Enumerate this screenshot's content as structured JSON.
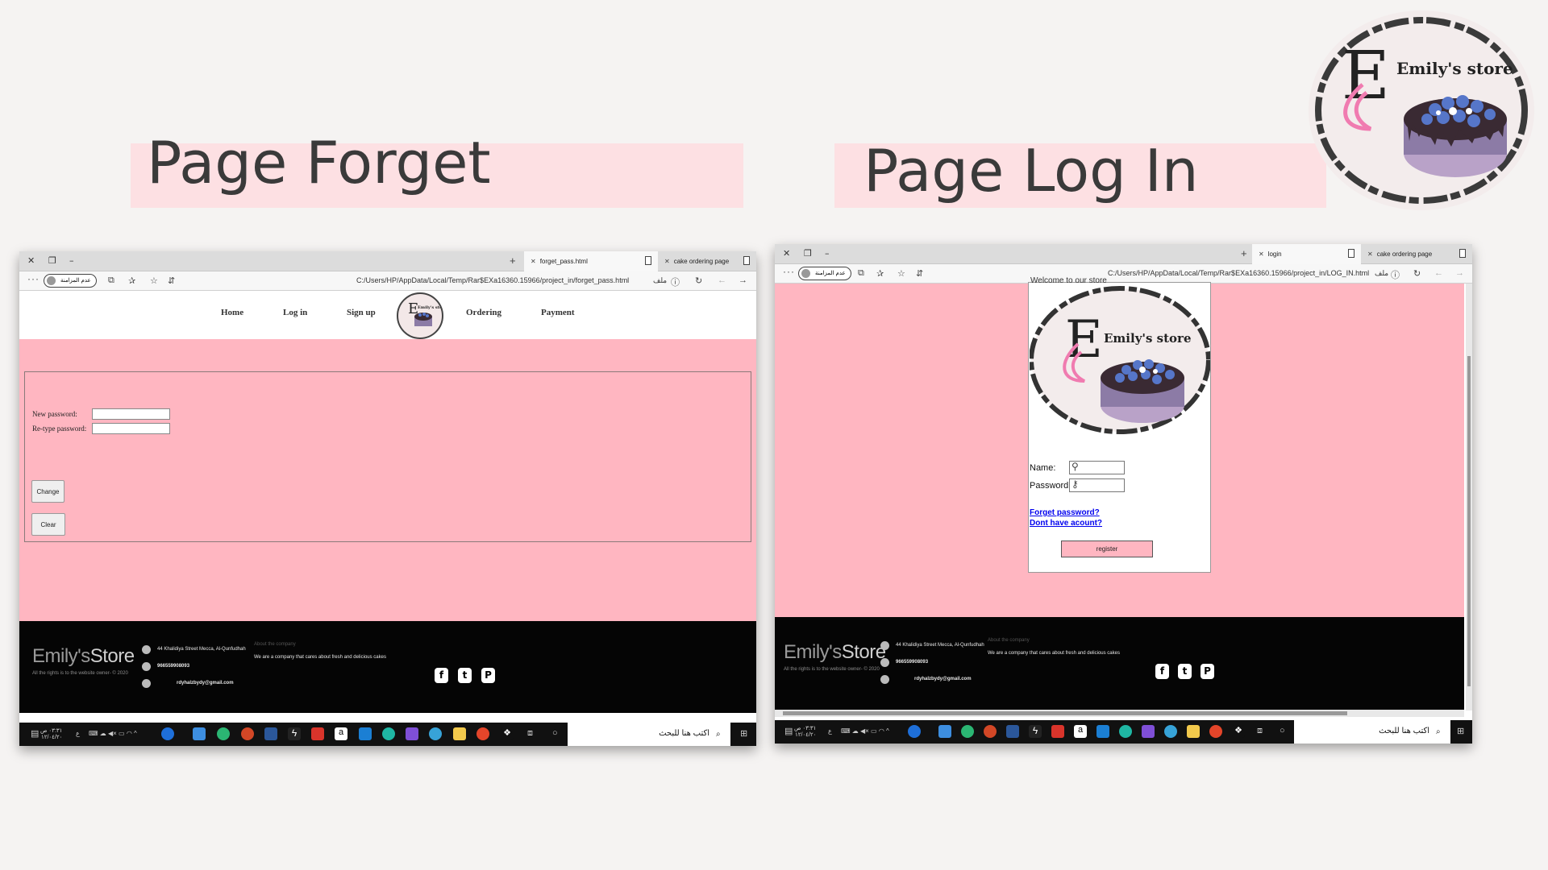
{
  "titles": {
    "forget": "Page Forget",
    "login": "Page Log In"
  },
  "logo": {
    "monogram": "E",
    "store_name": "Emily's store"
  },
  "forget_shot": {
    "tabs": [
      {
        "label": "forget_pass.html",
        "active": true
      },
      {
        "label": "cake ordering page",
        "active": false
      }
    ],
    "profile": "عدم المزامنة",
    "url": "C:/Users/HP/AppData/Local/Temp/Rar$EXa16360.15966/project_in/forget_pass.html",
    "file_label": "ملف",
    "nav": [
      "Home",
      "Log in",
      "Sign up",
      "Ordering",
      "Payment"
    ],
    "form": {
      "new_password_label": "New password:",
      "retype_label": "Re-type password:",
      "change_button": "Change",
      "clear_button": "Clear"
    }
  },
  "login_shot": {
    "tabs": [
      {
        "label": "login",
        "active": true
      },
      {
        "label": "cake ordering page",
        "active": false
      }
    ],
    "profile": "عدم المزامنة",
    "url": "C:/Users/HP/AppData/Local/Temp/Rar$EXa16360.15966/project_in/LOG_IN.html",
    "file_label": "ملف",
    "welcome": "Welcome to our store",
    "name_label": "Name:",
    "password_label": "Password:",
    "forget_link": "Forget password?",
    "signup_link": "Dont have acount?",
    "register_button": "register"
  },
  "footer": {
    "brand_a": "Emily's",
    "brand_b": "Store",
    "rights": "All the rights is to the website owner- © 2020",
    "address": "44 Khalidiya Street Mecca, Al-Qunfudhah",
    "phone": "966559908093",
    "email": "rdyhalzbydy@gmail.com",
    "about_heading": "About the company",
    "about_text": "We are a company that cares about fresh and delicious cakes"
  },
  "taskbar": {
    "search": "اكتب هنا للبحث",
    "time": "٠٣:٣١ ص",
    "date": "١٢/٠٤/٢٠",
    "lang": "ع"
  },
  "colors": {
    "page_pink": "#ffb6c1",
    "title_band": "#fde0e3",
    "footer_bg": "#050505"
  }
}
